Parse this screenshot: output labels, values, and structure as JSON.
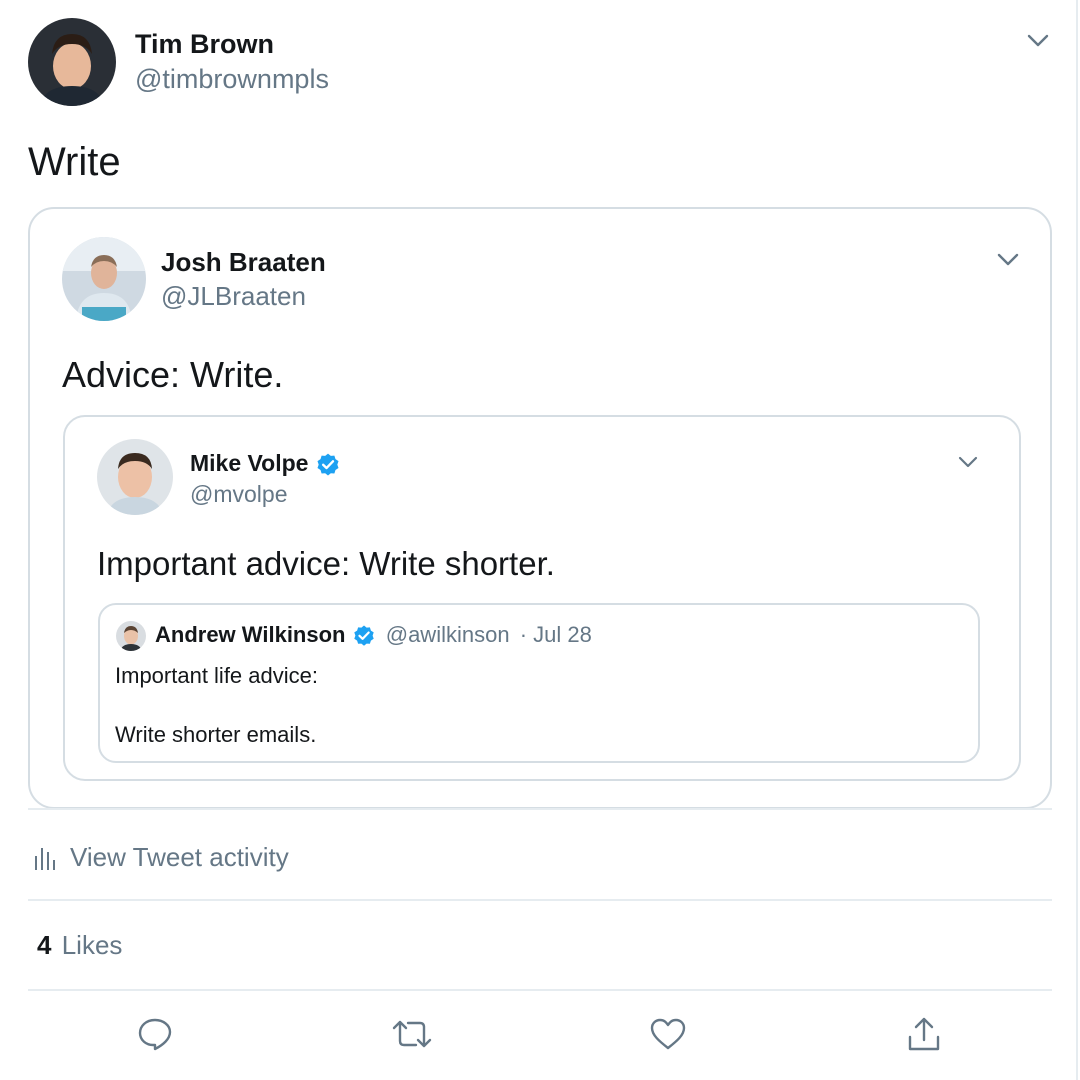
{
  "tweet": {
    "author": {
      "name": "Tim Brown",
      "handle": "@timbrownmpls"
    },
    "text": "Write",
    "quote": {
      "author": {
        "name": "Josh Braaten",
        "handle": "@JLBraaten"
      },
      "text": "Advice: Write.",
      "quote": {
        "author": {
          "name": "Mike Volpe",
          "handle": "@mvolpe",
          "verified": true
        },
        "text": "Important advice: Write shorter.",
        "quote": {
          "author": {
            "name": "Andrew Wilkinson",
            "handle": "@awilkinson",
            "verified": true
          },
          "meta": "· Jul 28",
          "text_line1": "Important life advice:",
          "text_line2": "Write shorter emails."
        }
      }
    }
  },
  "activity": {
    "label": "View Tweet activity",
    "icon": "analytics-icon"
  },
  "likes": {
    "count": "4",
    "label": "Likes"
  },
  "actions": [
    {
      "name": "reply",
      "icon": "reply-icon"
    },
    {
      "name": "retweet",
      "icon": "retweet-icon"
    },
    {
      "name": "like",
      "icon": "heart-icon"
    },
    {
      "name": "share",
      "icon": "share-icon"
    }
  ],
  "colors": {
    "verified": "#1da1f2",
    "secondary_text": "#657786",
    "divider": "#e6ecf0"
  }
}
